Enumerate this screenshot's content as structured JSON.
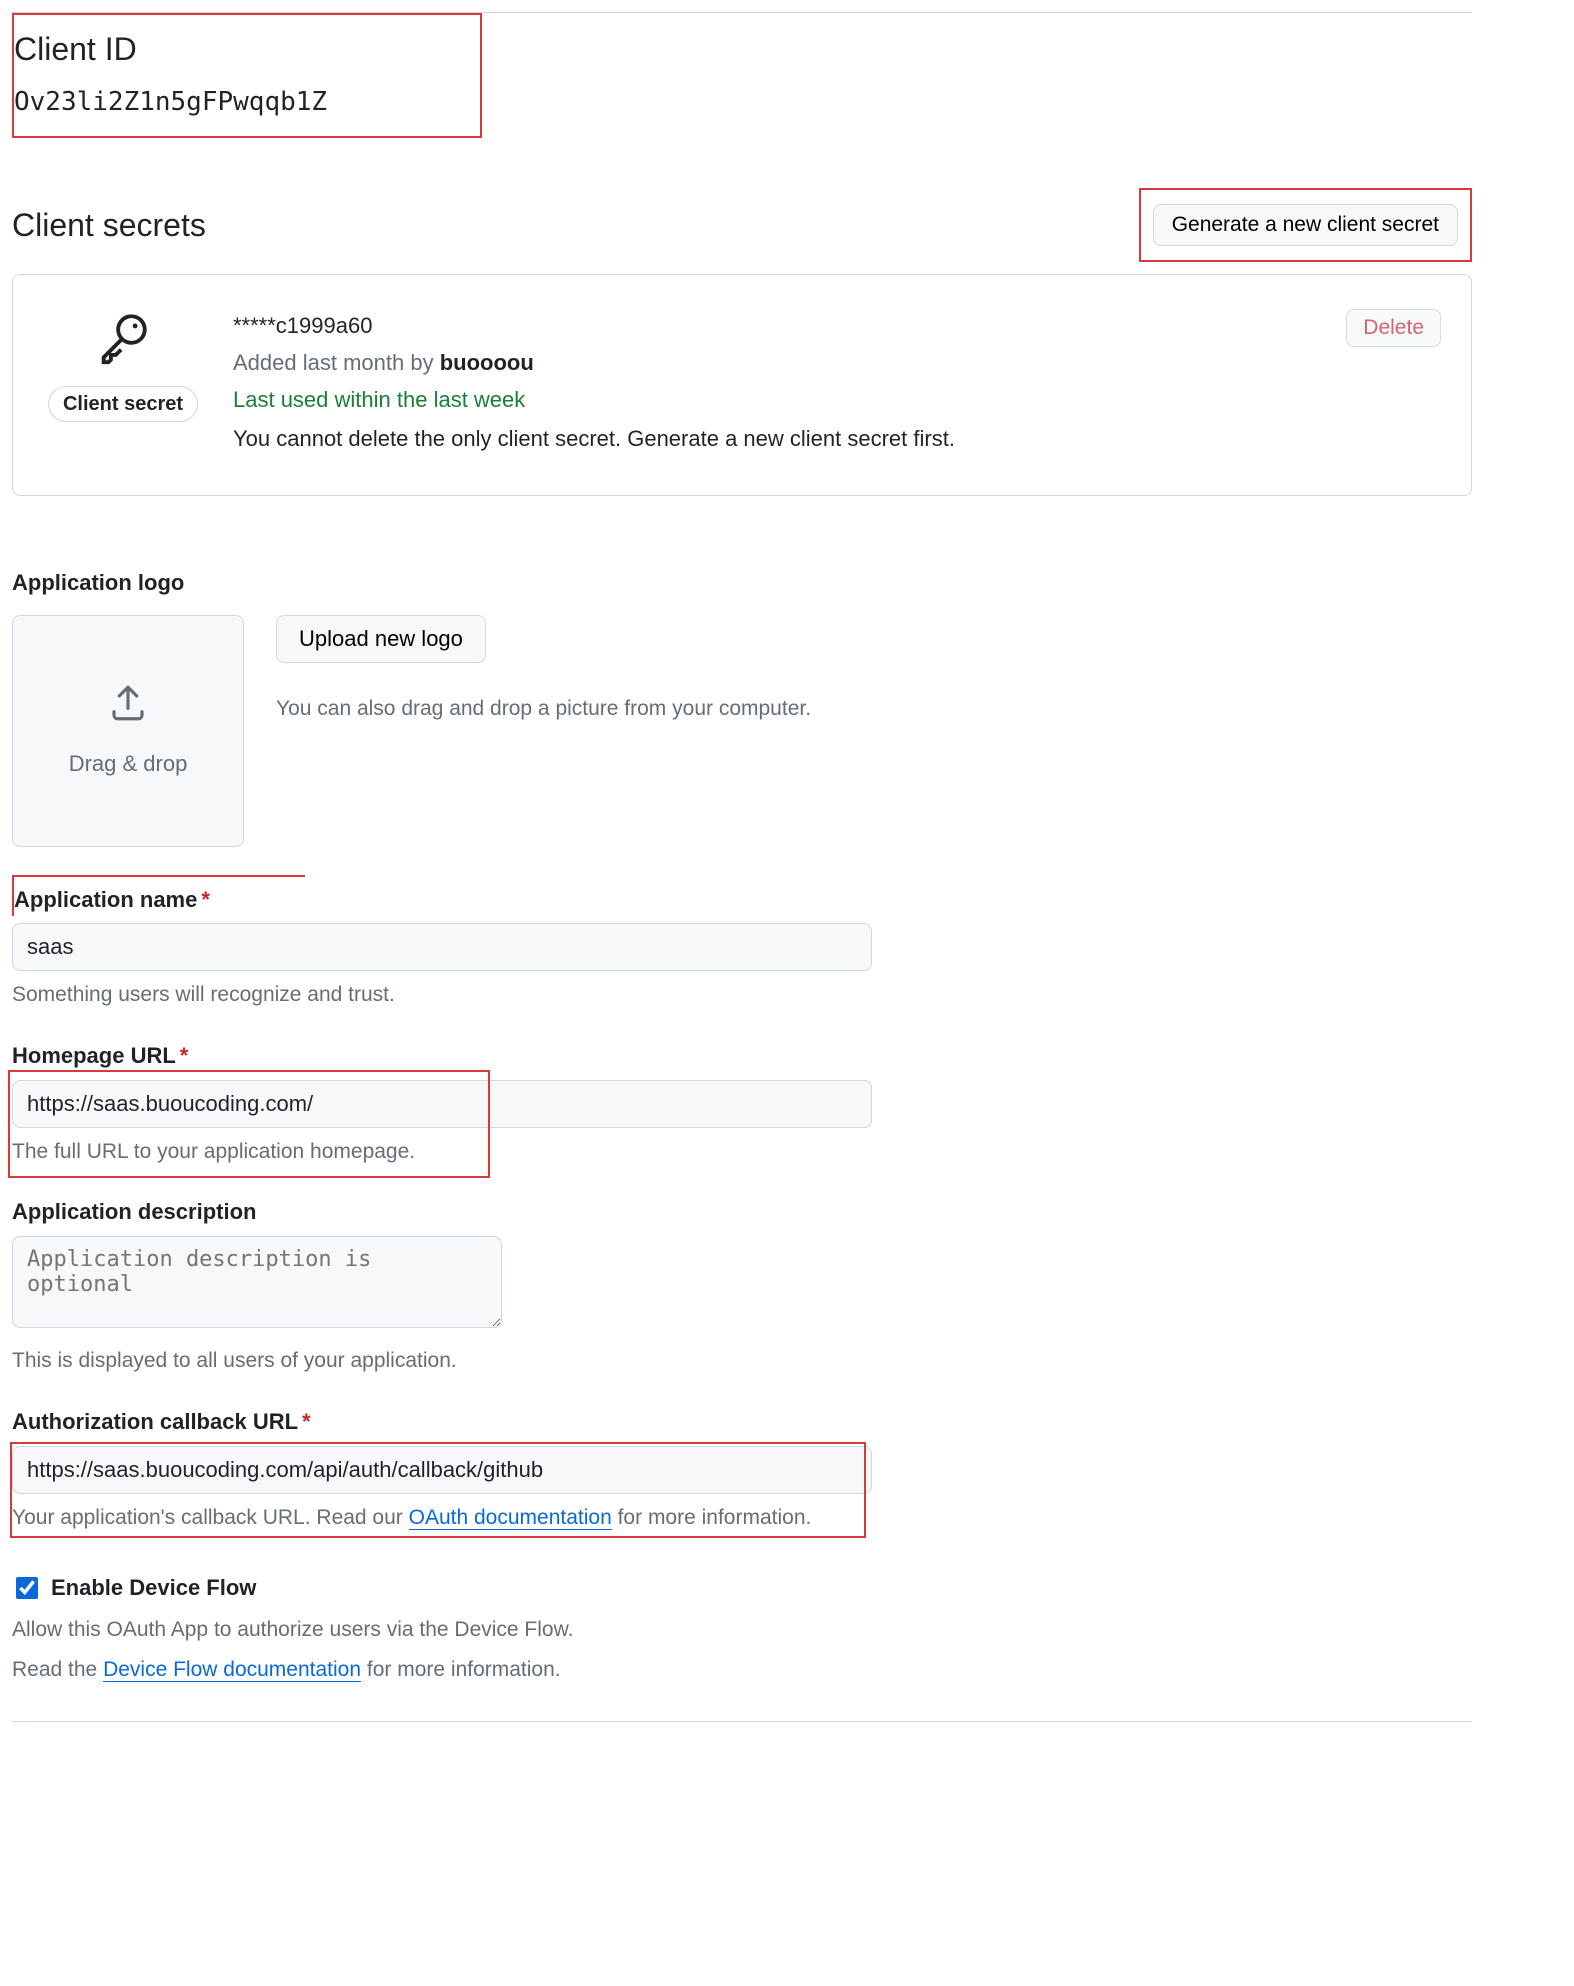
{
  "client_id": {
    "label": "Client ID",
    "value": "Ov23li2Z1n5gFPwqqb1Z"
  },
  "client_secrets": {
    "heading": "Client secrets",
    "generate_button": "Generate a new client secret",
    "secret": {
      "chip": "Client secret",
      "value": "*****c1999a60",
      "added_prefix": "Added last month by ",
      "added_user": "buoooou",
      "last_used": "Last used within the last week",
      "warn": "You cannot delete the only client secret. Generate a new client secret first.",
      "delete_label": "Delete"
    }
  },
  "logo": {
    "heading": "Application logo",
    "drop_label": "Drag & drop",
    "upload_button": "Upload new logo",
    "hint": "You can also drag and drop a picture from your computer."
  },
  "form": {
    "app_name": {
      "label": "Application name",
      "value": "saas",
      "hint": "Something users will recognize and trust."
    },
    "homepage": {
      "label": "Homepage URL",
      "value": "https://saas.buoucoding.com/",
      "hint": "The full URL to your application homepage."
    },
    "description": {
      "label": "Application description",
      "placeholder": "Application description is optional",
      "hint": "This is displayed to all users of your application."
    },
    "callback": {
      "label": "Authorization callback URL",
      "value": "https://saas.buoucoding.com/api/auth/callback/github",
      "hint_pre": "Your application's callback URL. Read our ",
      "hint_link": "OAuth documentation",
      "hint_post": " for more information."
    },
    "device_flow": {
      "label": "Enable Device Flow",
      "checked": true,
      "line1": "Allow this OAuth App to authorize users via the Device Flow.",
      "line2_pre": "Read the ",
      "line2_link": "Device Flow documentation",
      "line2_post": " for more information."
    }
  }
}
